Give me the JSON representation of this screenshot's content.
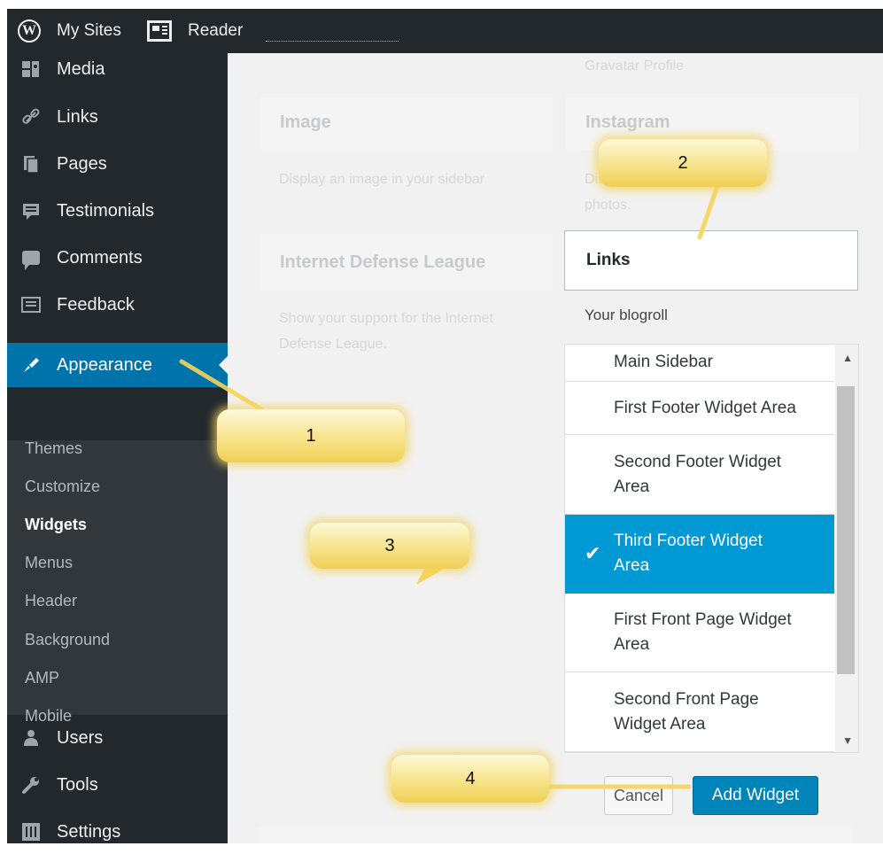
{
  "admin_bar": {
    "my_sites": "My Sites",
    "reader": "Reader"
  },
  "sidebar": {
    "items_top": [
      {
        "label": "Media",
        "icon": "media-icon"
      },
      {
        "label": "Links",
        "icon": "link-icon"
      },
      {
        "label": "Pages",
        "icon": "pages-icon"
      },
      {
        "label": "Testimonials",
        "icon": "testimonials-icon"
      },
      {
        "label": "Comments",
        "icon": "comments-icon"
      },
      {
        "label": "Feedback",
        "icon": "feedback-icon"
      }
    ],
    "current": {
      "label": "Appearance",
      "icon": "paintbrush-icon"
    },
    "submenu": [
      "Themes",
      "Customize",
      "Widgets",
      "Menus",
      "Header",
      "Background",
      "AMP",
      "Mobile"
    ],
    "submenu_active": "Widgets",
    "items_bottom": [
      {
        "label": "Users",
        "icon": "users-icon"
      },
      {
        "label": "Tools",
        "icon": "wrench-icon"
      },
      {
        "label": "Settings",
        "icon": "settings-icon"
      }
    ]
  },
  "widgets": {
    "gravatar_label": "Gravatar Profile",
    "image": {
      "title": "Image",
      "desc": "Display an image in your sidebar"
    },
    "instagram": {
      "title": "Instagram",
      "desc_line1": "Display your Instagram",
      "desc_line2": "photos."
    },
    "idl": {
      "title": "Internet Defense League",
      "desc_line1": "Show your support for the Internet",
      "desc_line2": "Defense League."
    },
    "links": {
      "title": "Links",
      "desc": "Your blogroll"
    }
  },
  "sidebar_chooser": {
    "options": [
      {
        "line1": "Main Sidebar",
        "line2": ""
      },
      {
        "line1": "First Footer Widget Area",
        "line2": ""
      },
      {
        "line1": "Second Footer Widget",
        "line2": "Area"
      },
      {
        "line1": "Third Footer Widget",
        "line2": "Area"
      },
      {
        "line1": "First Front Page Widget",
        "line2": "Area"
      },
      {
        "line1": "Second Front Page",
        "line2": "Widget Area"
      }
    ],
    "selected": "Third Footer Widget Area"
  },
  "buttons": {
    "cancel": "Cancel",
    "add_widget": "Add Widget"
  },
  "callouts": [
    "1",
    "2",
    "3",
    "4"
  ],
  "colors": {
    "admin_dark": "#23282d",
    "submenu_bg": "#32373c",
    "accent": "#0073aa",
    "selected_option": "#0099d3",
    "primary_button": "#0085ba",
    "callout": "#f7e38a"
  }
}
